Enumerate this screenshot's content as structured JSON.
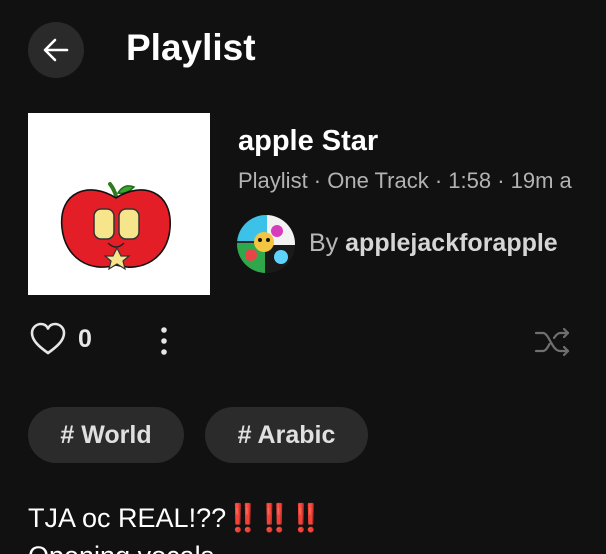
{
  "header": {
    "title": "Playlist"
  },
  "playlist": {
    "name": "apple Star",
    "meta": "Playlist · One Track · 1:58 · 19m a",
    "author_prefix": "By",
    "author_name": "applejackforapple",
    "likes": "0"
  },
  "tags": [
    {
      "label": "# World"
    },
    {
      "label": "# Arabic"
    }
  ],
  "description": {
    "line1": "TJA oc REAL!??",
    "line1_emphasis": "‼️‼️‼️",
    "line2": "Opening vocals"
  },
  "icons": {
    "back": "arrow-left-icon",
    "like": "heart-icon",
    "more": "vertical-dots-icon",
    "shuffle": "shuffle-icon"
  },
  "colors": {
    "background": "#111111",
    "surface": "#2a2a2a",
    "text_primary": "#ffffff",
    "text_secondary": "#b3b3b3",
    "apple_red": "#e41e26",
    "emphasis_red": "#e0282e"
  }
}
